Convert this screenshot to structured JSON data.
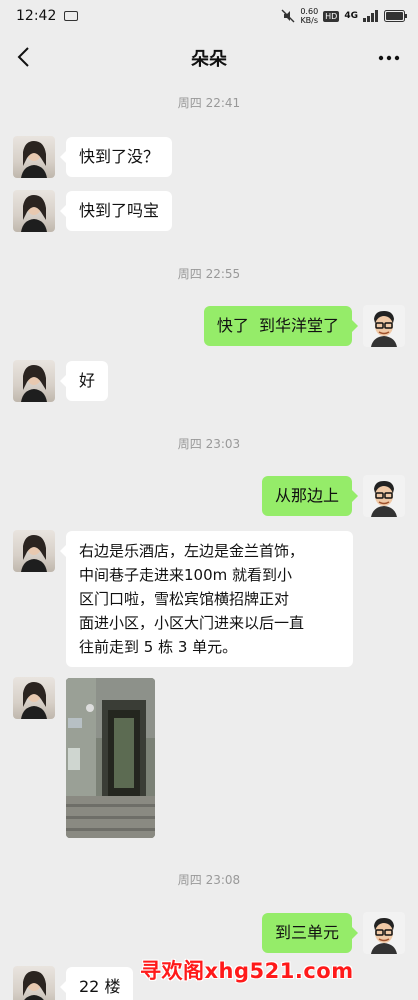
{
  "status_bar": {
    "time": "12:42",
    "net_speed": "0.60\nKB/s",
    "hd_badge": "HD",
    "signal_label": "4G"
  },
  "nav": {
    "title": "朵朵"
  },
  "messages": {
    "t1": "周四 22:41",
    "m1": "快到了没？",
    "m2": "快到了吗宝",
    "t2": "周四 22:55",
    "m3": "快了  到华洋堂了",
    "m4": "好",
    "t3": "周四 23:03",
    "m5": "从那边上",
    "m6": "右边是乐酒店，左边是金兰首饰，\n中间巷子走进来100m 就看到小\n区门口啦，雪松宾馆横招牌正对\n面进小区，小区大门进来以后一直\n往前走到 5 栋 3 单元。",
    "t4": "周四 23:08",
    "m7": "到三单元",
    "m8": "22 楼"
  },
  "watermark": "寻欢阁xhg521.com",
  "colors": {
    "background": "#ededed",
    "my_bubble": "#95ec69",
    "their_bubble": "#ffffff",
    "watermark": "#ff1a1a"
  }
}
